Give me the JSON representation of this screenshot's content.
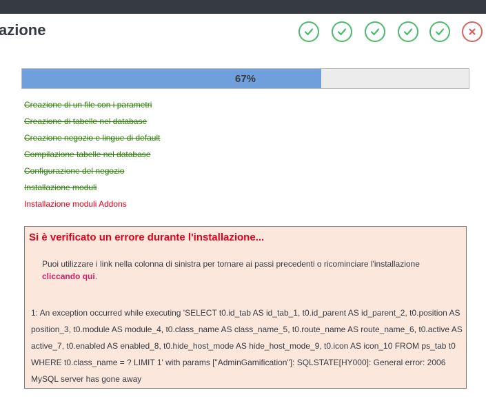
{
  "header": {
    "title": "azione"
  },
  "steps": [
    {
      "status": "done",
      "icon": "check-icon"
    },
    {
      "status": "done",
      "icon": "check-icon"
    },
    {
      "status": "done",
      "icon": "check-icon"
    },
    {
      "status": "done",
      "icon": "check-icon"
    },
    {
      "status": "done",
      "icon": "check-icon"
    },
    {
      "status": "error",
      "icon": "close-icon"
    }
  ],
  "progress": {
    "percent": 67,
    "label": "67%"
  },
  "tasks": [
    {
      "label": "Creazione di un file con i parametri",
      "status": "done"
    },
    {
      "label": "Creazione di tabelle nel database",
      "status": "done"
    },
    {
      "label": "Creazione negozio e lingue di default",
      "status": "done"
    },
    {
      "label": "Compilazione tabelle nel database",
      "status": "done"
    },
    {
      "label": "Configurazione del negozio",
      "status": "done"
    },
    {
      "label": "Installazione moduli",
      "status": "done"
    },
    {
      "label": "Installazione moduli Addons",
      "status": "error"
    }
  ],
  "error": {
    "title": "Si è verificato un errore durante l'installazione...",
    "help_text": "Puoi utilizzare i link nella colonna di sinistra per tornare ai passi precedenti o ricominciare l'installazione",
    "help_link": "cliccando qui",
    "help_end": ".",
    "detail": "1: An exception occurred while executing 'SELECT t0.id_tab AS id_tab_1, t0.id_parent AS id_parent_2, t0.position AS position_3, t0.module AS module_4, t0.class_name AS class_name_5, t0.route_name AS route_name_6, t0.active AS active_7, t0.enabled AS enabled_8, t0.hide_host_mode AS hide_host_mode_9, t0.icon AS icon_10 FROM ps_tab t0 WHERE t0.class_name = ? LIMIT 1' with params [\"AdminGamification\"]: SQLSTATE[HY000]: General error: 2006 MySQL server has gone away"
  },
  "colors": {
    "success": "#4cbb6c",
    "error": "#d4645f",
    "progress": "#70a0db",
    "done_text": "#2e7d0a",
    "error_text": "#e3001b",
    "link": "#c9216c"
  }
}
